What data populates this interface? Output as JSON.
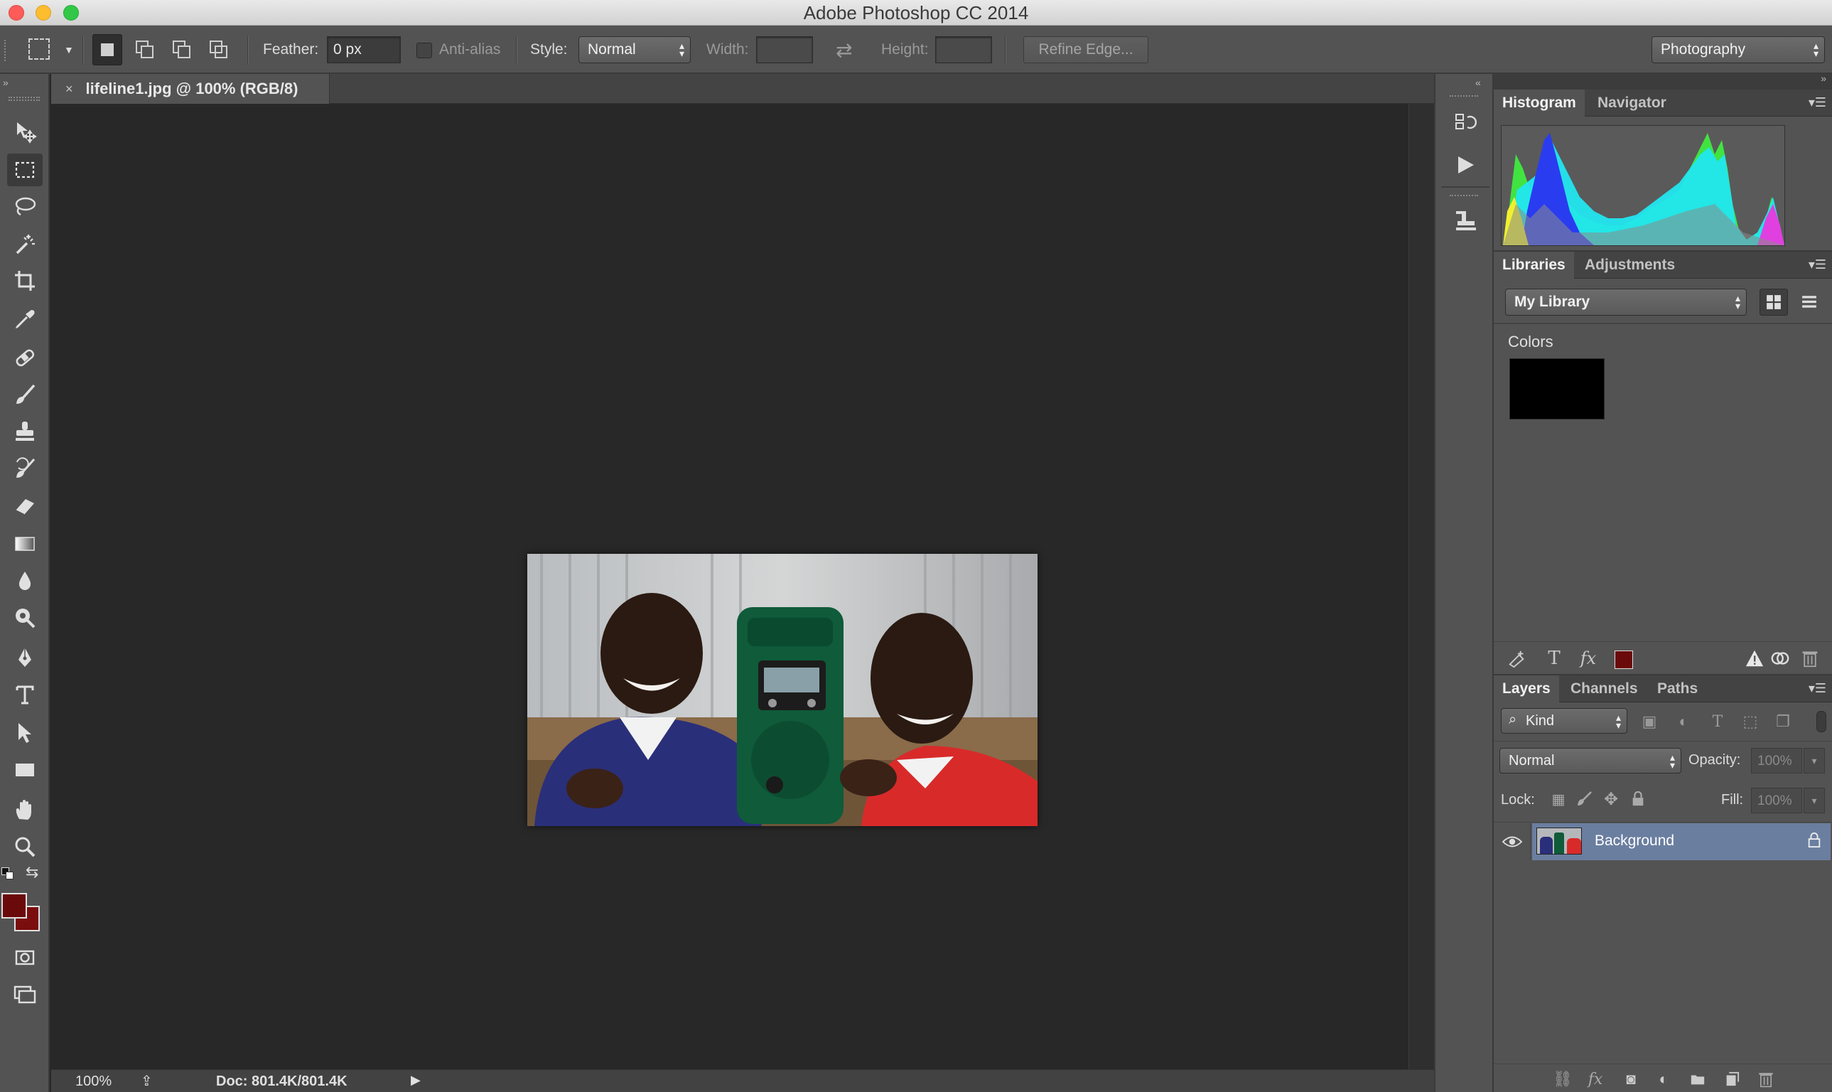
{
  "window": {
    "title": "Adobe Photoshop CC 2014"
  },
  "options_bar": {
    "feather_label": "Feather:",
    "feather_value": "0 px",
    "anti_alias_label": "Anti-alias",
    "style_label": "Style:",
    "style_value": "Normal",
    "width_label": "Width:",
    "height_label": "Height:",
    "refine_edge_label": "Refine Edge...",
    "workspace_value": "Photography"
  },
  "document": {
    "tab_label": "lifeline1.jpg @ 100% (RGB/8)",
    "close_glyph": "×"
  },
  "status_bar": {
    "zoom": "100%",
    "doc_info": "Doc: 801.4K/801.4K"
  },
  "histogram_panel": {
    "tabs": [
      "Histogram",
      "Navigator"
    ]
  },
  "libraries_panel": {
    "tabs": [
      "Libraries",
      "Adjustments"
    ],
    "library_select": "My Library",
    "section_title": "Colors",
    "color_swatch": "#000000"
  },
  "layers_panel": {
    "tabs": [
      "Layers",
      "Channels",
      "Paths"
    ],
    "filter_kind": "Kind",
    "blend_mode": "Normal",
    "opacity_label": "Opacity:",
    "opacity_value": "100%",
    "lock_label": "Lock:",
    "fill_label": "Fill:",
    "fill_value": "100%",
    "layers": [
      {
        "name": "Background",
        "visible": true,
        "locked": true
      }
    ]
  },
  "colors": {
    "foreground": "#6b0a0a",
    "background": "#7a0d0d",
    "selection_highlight": "#6a7ea0"
  }
}
